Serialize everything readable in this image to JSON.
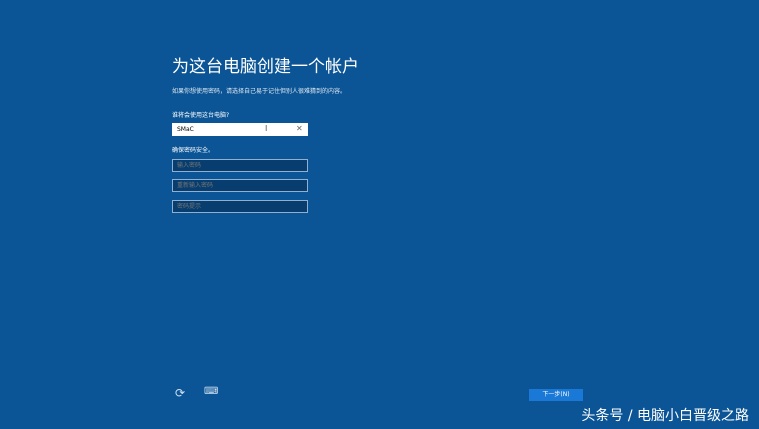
{
  "title": "为这台电脑创建一个帐户",
  "description": "如果你想使用密码，请选择自己易于记住但别人很难猜到的内容。",
  "name_label": "谁将会使用这台电脑?",
  "name_value": "SMaC",
  "password_label": "确保密码安全。",
  "password_placeholder": "输入密码",
  "reenter_placeholder": "重新输入密码",
  "hint_placeholder": "密码提示",
  "next_label": "下一步(N)",
  "watermark": "头条号 / 电脑小白晋级之路"
}
